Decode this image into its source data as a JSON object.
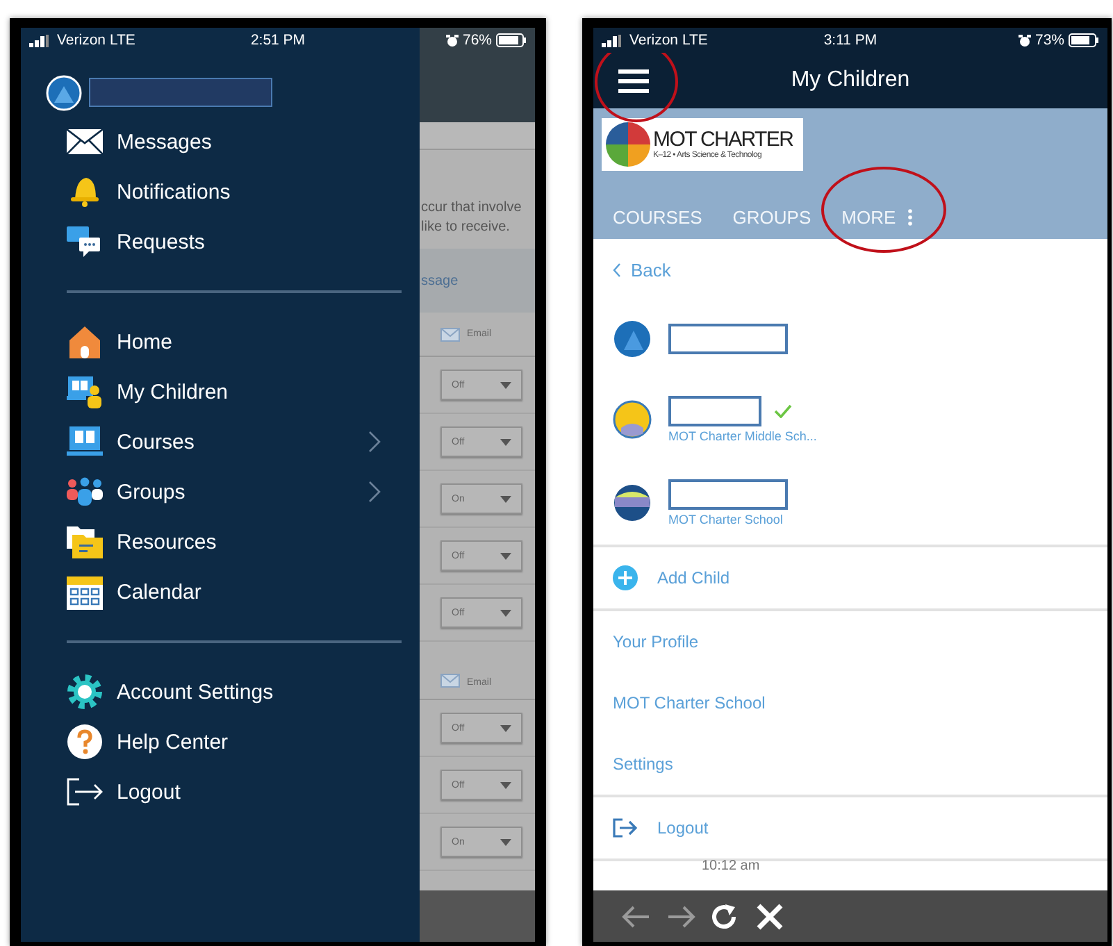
{
  "left_phone": {
    "status_bar": {
      "carrier": "Verizon LTE",
      "time": "2:51 PM",
      "battery": "76%"
    },
    "drawer": {
      "sections": [
        {
          "items": [
            {
              "label": "Messages",
              "submenu": false
            },
            {
              "label": "Notifications",
              "submenu": false
            },
            {
              "label": "Requests",
              "submenu": false
            }
          ]
        },
        {
          "items": [
            {
              "label": "Home",
              "submenu": false
            },
            {
              "label": "My Children",
              "submenu": false
            },
            {
              "label": "Courses",
              "submenu": true
            },
            {
              "label": "Groups",
              "submenu": true
            },
            {
              "label": "Resources",
              "submenu": false
            },
            {
              "label": "Calendar",
              "submenu": false
            }
          ]
        },
        {
          "items": [
            {
              "label": "Account Settings",
              "submenu": false
            },
            {
              "label": "Help Center",
              "submenu": false
            },
            {
              "label": "Logout",
              "submenu": false
            }
          ]
        }
      ]
    },
    "background_page": {
      "text_lines": [
        "ccur that involve",
        "like to receive."
      ],
      "link": "ssage",
      "groups": [
        {
          "header": "Email",
          "dropdowns": [
            "Off",
            "Off",
            "On",
            "Off",
            "Off"
          ]
        },
        {
          "header": "Email",
          "dropdowns": [
            "Off",
            "Off",
            "On"
          ]
        }
      ]
    }
  },
  "right_phone": {
    "status_bar": {
      "carrier": "Verizon LTE",
      "time": "3:11 PM",
      "battery": "73%"
    },
    "header": {
      "title": "My Children",
      "menu_circled": true
    },
    "logo": {
      "title": "MOT CHARTER",
      "subtitle": "K–12 • Arts Science & Technolog"
    },
    "tabs": [
      {
        "label": "COURSES",
        "kind": "plain",
        "circled": false
      },
      {
        "label": "GROUPS",
        "kind": "plain",
        "circled": false
      },
      {
        "label": "MORE",
        "kind": "more",
        "circled": true
      }
    ],
    "back_link": "Back",
    "children": [
      {
        "verified": false
      },
      {
        "verified": true,
        "school": "MOT Charter Middle Sch..."
      },
      {
        "verified": false,
        "school": "MOT Charter School"
      }
    ],
    "add_child": "Add Child",
    "links": [
      "Your Profile",
      "MOT Charter School",
      "Settings"
    ],
    "logout": "Logout",
    "timestamp": "10:12 am",
    "toolbar": [
      {
        "kind": "back",
        "disabled": true
      },
      {
        "kind": "forward",
        "disabled": true
      },
      {
        "kind": "reload",
        "disabled": false
      },
      {
        "kind": "close",
        "disabled": false
      }
    ]
  }
}
